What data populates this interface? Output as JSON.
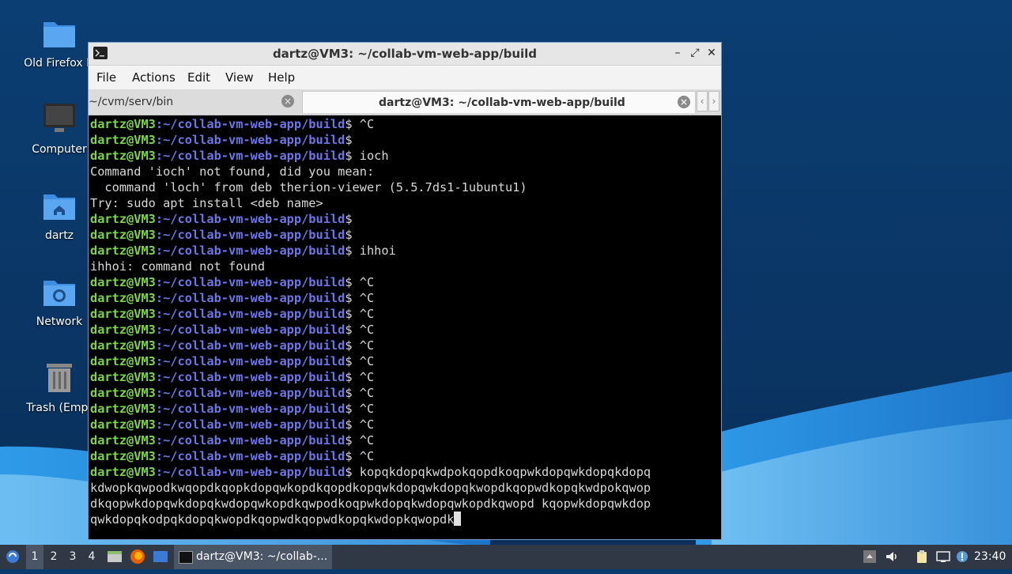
{
  "desktop": {
    "icons": [
      {
        "label": "Old Firefox D",
        "icon": "folder-icon"
      },
      {
        "label": "Computer",
        "icon": "computer-icon"
      },
      {
        "label": "dartz",
        "icon": "home-folder-icon"
      },
      {
        "label": "Network",
        "icon": "network-folder-icon"
      },
      {
        "label": "Trash (Empt",
        "icon": "trash-icon"
      }
    ]
  },
  "window": {
    "title": "dartz@VM3: ~/collab-vm-web-app/build",
    "menu": [
      "File",
      "Actions",
      "Edit",
      "View",
      "Help"
    ],
    "tabs": [
      {
        "label": "~/cvm/serv/bin",
        "active": false
      },
      {
        "label": "dartz@VM3: ~/collab-vm-web-app/build",
        "active": true
      }
    ]
  },
  "terminal": {
    "user": "dartz@VM3",
    "path": ":~/collab-vm-web-app/build",
    "lines": [
      {
        "prompt": true,
        "text": "$ ^C"
      },
      {
        "prompt": true,
        "text": "$"
      },
      {
        "prompt": true,
        "text": "$ ioch"
      },
      {
        "prompt": false,
        "text": "Command 'ioch' not found, did you mean:"
      },
      {
        "prompt": false,
        "text": "  command 'loch' from deb therion-viewer (5.5.7ds1-1ubuntu1)"
      },
      {
        "prompt": false,
        "text": "Try: sudo apt install <deb name>"
      },
      {
        "prompt": true,
        "text": "$"
      },
      {
        "prompt": true,
        "text": "$"
      },
      {
        "prompt": true,
        "text": "$ ihhoi"
      },
      {
        "prompt": false,
        "text": "ihhoi: command not found"
      },
      {
        "prompt": true,
        "text": "$ ^C"
      },
      {
        "prompt": true,
        "text": "$ ^C"
      },
      {
        "prompt": true,
        "text": "$ ^C"
      },
      {
        "prompt": true,
        "text": "$ ^C"
      },
      {
        "prompt": true,
        "text": "$ ^C"
      },
      {
        "prompt": true,
        "text": "$ ^C"
      },
      {
        "prompt": true,
        "text": "$ ^C"
      },
      {
        "prompt": true,
        "text": "$ ^C"
      },
      {
        "prompt": true,
        "text": "$ ^C"
      },
      {
        "prompt": true,
        "text": "$ ^C"
      },
      {
        "prompt": true,
        "text": "$ ^C"
      },
      {
        "prompt": true,
        "text": "$ ^C"
      },
      {
        "prompt": true,
        "text": "$ kopqkdopqkwdpokqopdkoqpwkdopqwkdopqkdopq"
      },
      {
        "prompt": false,
        "text": "kdwopkqwpodkwqopdkqopkdopqwkopdkqopdkopqwkdopqwkdopqkwopdkqopwdkopqkwdpokqwop"
      },
      {
        "prompt": false,
        "text": "dkqopwkdopqwkdopqkwdopqwkopdkqwpodkoqpwkdopqkwdopqwkopdkqwopd kqopwkdopqwkdop"
      },
      {
        "prompt": false,
        "text": "qwkdopqkodpqkdopqkwopdkqopwdkqopwdkopqkwdopkqwopdk",
        "cursor": true
      }
    ]
  },
  "taskbar": {
    "workspaces": [
      "1",
      "2",
      "3",
      "4"
    ],
    "active_workspace": "1",
    "task_label": "dartz@VM3: ~/collab-...",
    "clock": "23:40"
  },
  "colors": {
    "prompt_user": "#7cd54a",
    "prompt_path": "#6e75e6",
    "terminal_bg": "#000000",
    "desktop_bg": "#0a3b6f",
    "taskbar_bg": "#303845"
  }
}
